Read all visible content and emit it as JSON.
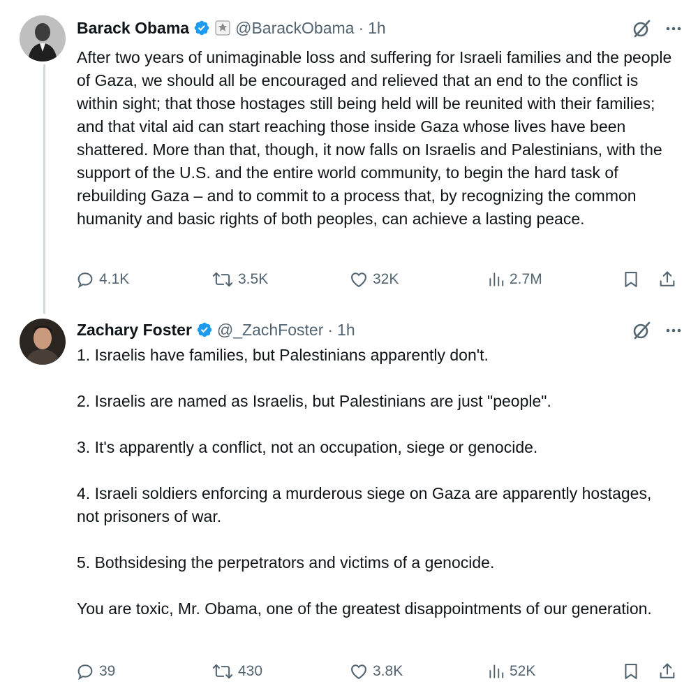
{
  "tweets": [
    {
      "author": {
        "name": "Barack Obama",
        "handle": "@BarackObama",
        "time": "1h",
        "verified": true,
        "government_badge": true
      },
      "text": [
        "After two years of unimaginable loss and suffering for Israeli families and the people of Gaza, we should all be encouraged and relieved that an end to the conflict is within sight; that those hostages still being held will be reunited with their families; and that vital aid can start reaching those inside Gaza whose lives have been shattered. More than that, though, it now falls on Israelis and Palestinians, with the support of the U.S. and the entire world community, to begin the hard task of rebuilding Gaza – and to commit to a process that, by recognizing the common humanity and basic rights of both peoples, can achieve a lasting peace."
      ],
      "stats": {
        "replies": "4.1K",
        "reposts": "3.5K",
        "likes": "32K",
        "views": "2.7M"
      }
    },
    {
      "author": {
        "name": "Zachary Foster",
        "handle": "@_ZachFoster",
        "time": "1h",
        "verified": true
      },
      "text": [
        "1. Israelis have families, but Palestinians apparently don't.",
        "2. Israelis are named as Israelis, but Palestinians are just \"people\".",
        "3. It's apparently a conflict, not an occupation, siege or genocide.",
        "4. Israeli soldiers enforcing a murderous siege on Gaza are apparently hostages, not prisoners of war.",
        "5. Bothsidesing the perpetrators and victims of a genocide.",
        "You are toxic, Mr. Obama, one of the greatest disappointments of our generation."
      ],
      "stats": {
        "replies": "39",
        "reposts": "430",
        "likes": "3.8K",
        "views": "52K"
      }
    }
  ],
  "separator": "·",
  "colors": {
    "text": "#0f1419",
    "secondary": "#536471",
    "verified_blue": "#1d9bf0",
    "thread_line": "#cfd9de"
  },
  "icons": [
    "verified-badge-icon",
    "government-seal-icon",
    "grok-icon",
    "more-icon",
    "reply-icon",
    "repost-icon",
    "like-icon",
    "views-icon",
    "bookmark-icon",
    "share-icon"
  ]
}
